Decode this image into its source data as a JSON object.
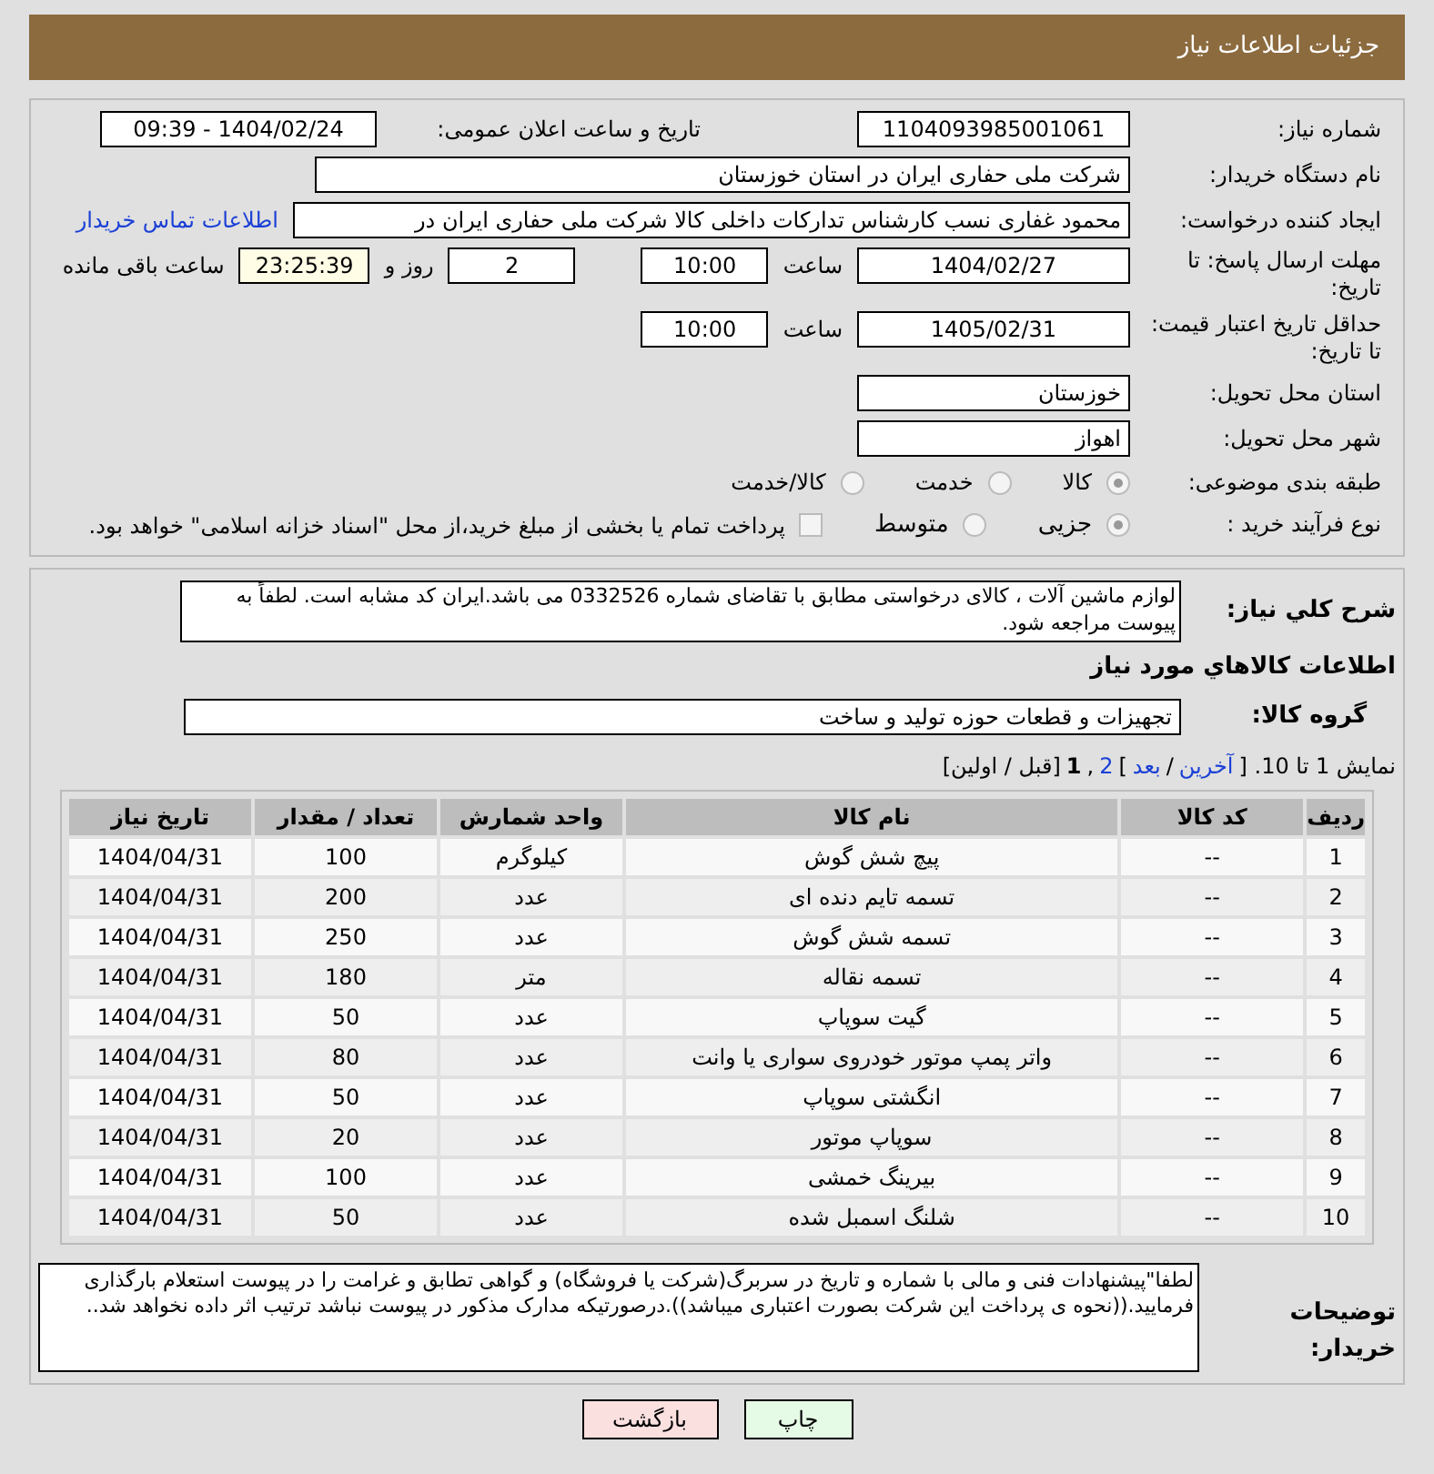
{
  "header": {
    "title": "جزئیات اطلاعات نیاز"
  },
  "fields": {
    "need_number": {
      "label": "شماره نیاز:",
      "value": "1104093985001061"
    },
    "announce": {
      "label": "تاریخ و ساعت اعلان عمومی:",
      "value": "1404/02/24 - 09:39"
    },
    "buyer_org": {
      "label": "نام دستگاه خریدار:",
      "value": "شرکت ملی حفاری ایران در استان خوزستان"
    },
    "creator": {
      "label": "ایجاد کننده درخواست:",
      "value": "محمود غفاری نسب کارشناس تدارکات داخلی  کالا شرکت ملی حفاری ایران در",
      "link": "اطلاعات تماس خریدار"
    },
    "deadline": {
      "label": "مهلت ارسال پاسخ: تا تاریخ:",
      "date": "1404/02/27",
      "time_label": "ساعت",
      "time": "10:00",
      "days": "2",
      "days_label": "روز و",
      "remaining": "23:25:39",
      "remaining_label": "ساعت باقی مانده"
    },
    "validity": {
      "label": "حداقل تاریخ اعتبار قیمت: تا تاریخ:",
      "date": "1405/02/31",
      "time_label": "ساعت",
      "time": "10:00"
    },
    "province": {
      "label": "استان محل تحویل:",
      "value": "خوزستان"
    },
    "city": {
      "label": "شهر محل تحویل:",
      "value": "اهواز"
    }
  },
  "category": {
    "label": "طبقه بندی موضوعی:",
    "options": [
      {
        "label": "کالا",
        "selected": true
      },
      {
        "label": "خدمت",
        "selected": false
      },
      {
        "label": "کالا/خدمت",
        "selected": false
      }
    ]
  },
  "process": {
    "label": "نوع فرآیند خرید :",
    "options": [
      {
        "label": "جزیی",
        "selected": true
      },
      {
        "label": "متوسط",
        "selected": false
      }
    ],
    "payment": {
      "checked": false,
      "label": "پرداخت تمام یا بخشی از مبلغ خرید،از محل \"اسناد خزانه اسلامی\" خواهد بود."
    }
  },
  "description": {
    "label": "شرح کلي نياز:",
    "value": "لوازم ماشین آلات ، کالای درخواستی مطابق با تقاضای شماره 0332526 می باشد.ایران کد مشابه است. لطفاً به پیوست مراجعه شود."
  },
  "goods_title": "اطلاعات کالاهاي مورد نياز",
  "goods_group": {
    "label": "گروه کالا:",
    "value": "تجهیزات و قطعات حوزه تولید و ساخت"
  },
  "pager": {
    "prefix": "نمایش 1 تا 10. [",
    "last": "آخرین",
    "sep1": "/",
    "next": "بعد",
    "close": "]",
    "page2": "2",
    "comma": ",",
    "page1": "1",
    "rest": "[قبل / اولین]"
  },
  "table": {
    "columns": [
      "ردیف",
      "کد کالا",
      "نام کالا",
      "واحد شمارش",
      "تعداد / مقدار",
      "تاریخ نیاز"
    ],
    "rows": [
      [
        "1",
        "--",
        "پیچ شش گوش",
        "کیلوگرم",
        "100",
        "1404/04/31"
      ],
      [
        "2",
        "--",
        "تسمه تایم دنده ای",
        "عدد",
        "200",
        "1404/04/31"
      ],
      [
        "3",
        "--",
        "تسمه شش گوش",
        "عدد",
        "250",
        "1404/04/31"
      ],
      [
        "4",
        "--",
        "تسمه نقاله",
        "متر",
        "180",
        "1404/04/31"
      ],
      [
        "5",
        "--",
        "گیت سوپاپ",
        "عدد",
        "50",
        "1404/04/31"
      ],
      [
        "6",
        "--",
        "واتر پمپ موتور خودروی سواری یا وانت",
        "عدد",
        "80",
        "1404/04/31"
      ],
      [
        "7",
        "--",
        "انگشتی سوپاپ",
        "عدد",
        "50",
        "1404/04/31"
      ],
      [
        "8",
        "--",
        "سوپاپ موتور",
        "عدد",
        "20",
        "1404/04/31"
      ],
      [
        "9",
        "--",
        "بیرینگ خمشی",
        "عدد",
        "100",
        "1404/04/31"
      ],
      [
        "10",
        "--",
        "شلنگ اسمبل شده",
        "عدد",
        "50",
        "1404/04/31"
      ]
    ]
  },
  "notes": {
    "label": "توضیحات خریدار:",
    "value": "لطفا\"پیشنهادات فنی و مالی با شماره و تاریخ در سربرگ(شرکت یا فروشگاه) و گواهی تطابق و غرامت را در پیوست استعلام بارگذاری فرمایید.((نحوه ی پرداخت این شرکت بصورت اعتباری میباشد)).درصورتیکه مدارک مذکور در پیوست نباشد ترتیب اثر داده نخواهد شد.."
  },
  "buttons": [
    {
      "label": "چاپ",
      "kind": "print"
    },
    {
      "label": "بازگشت",
      "kind": "back"
    }
  ]
}
